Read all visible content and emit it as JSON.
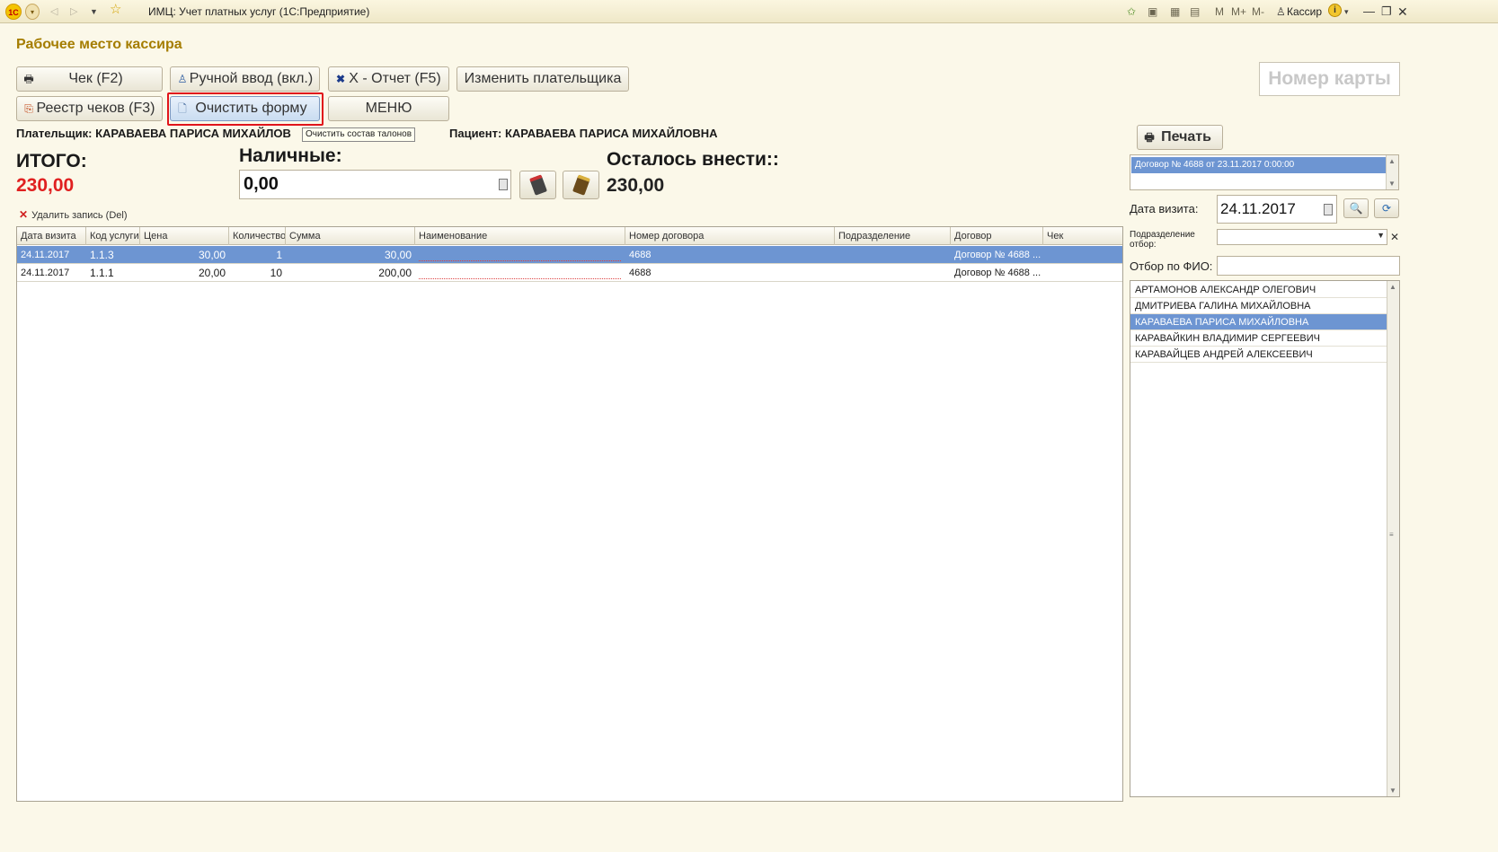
{
  "titlebar": {
    "logo": "1C",
    "app_title": "ИМЦ: Учет платных услуг  (1С:Предприятие)",
    "user_label": "Кассир",
    "m_labels": [
      "M",
      "M+",
      "M-"
    ]
  },
  "form": {
    "title": "Рабочее место кассира"
  },
  "toolbar": {
    "receipt_label": "Чек (F2)",
    "manual_input_label": "Ручной ввод (вкл.)",
    "x_report_label": "X - Отчет (F5)",
    "change_payer_label": "Изменить плательщика",
    "receipt_registry_label": "Реестр чеков (F3)",
    "clear_form_label": "Очистить форму",
    "menu_label": "МЕНЮ"
  },
  "card_number_placeholder": "Номер карты",
  "tooltip": "Очистить состав талонов",
  "payer": "Плательщик: КАРАВАЕВА ПАРИСА МИХАЙЛОВ",
  "patient": "Пациент: КАРАВАЕВА ПАРИСА МИХАЙЛОВНА",
  "totals": {
    "total_label": "ИТОГО:",
    "total_value": "230,00",
    "cash_label": "Наличные:",
    "cash_value": "0,00",
    "remaining_label": "Осталось внести::",
    "remaining_value": "230,00"
  },
  "delete_record_label": "Удалить запись (Del)",
  "table": {
    "columns": [
      "Дата визита",
      "Код услуги",
      "Цена",
      "Количество",
      "Сумма",
      "Наименование",
      "Номер договора",
      "Подразделение",
      "Договор",
      "Чек"
    ],
    "rows": [
      {
        "date": "24.11.2017",
        "code": "1.1.3",
        "price": "30,00",
        "qty": "1",
        "sum": "30,00",
        "name": "",
        "contract_no": "4688",
        "department": "",
        "contract": "Договор № 4688 ...",
        "receipt": ""
      },
      {
        "date": "24.11.2017",
        "code": "1.1.1",
        "price": "20,00",
        "qty": "10",
        "sum": "200,00",
        "name": "",
        "contract_no": "4688",
        "department": "",
        "contract": "Договор № 4688 ...",
        "receipt": ""
      }
    ]
  },
  "right_panel": {
    "print_label": "Печать",
    "contracts": [
      "Договор № 4688 от 23.11.2017 0:00:00"
    ],
    "visit_date_label": "Дата визита:",
    "visit_date_value": "24.11.2017",
    "department_filter_label": "Подразделение отбор:",
    "fio_filter_label": "Отбор по ФИО:",
    "patients": [
      "АРТАМОНОВ АЛЕКСАНДР ОЛЕГОВИЧ",
      "ДМИТРИЕВА ГАЛИНА МИХАЙЛОВНА",
      "КАРАВАЕВА ПАРИСА МИХАЙЛОВНА",
      "КАРАВАЙКИН ВЛАДИМИР СЕРГЕЕВИЧ",
      "КАРАВАЙЦЕВ АНДРЕЙ АЛЕКСЕЕВИЧ"
    ]
  },
  "colors": {
    "title_accent": "#a57d00",
    "selection": "#6d95d2",
    "total_red": "#e02020",
    "focus_red": "#e0141b"
  }
}
